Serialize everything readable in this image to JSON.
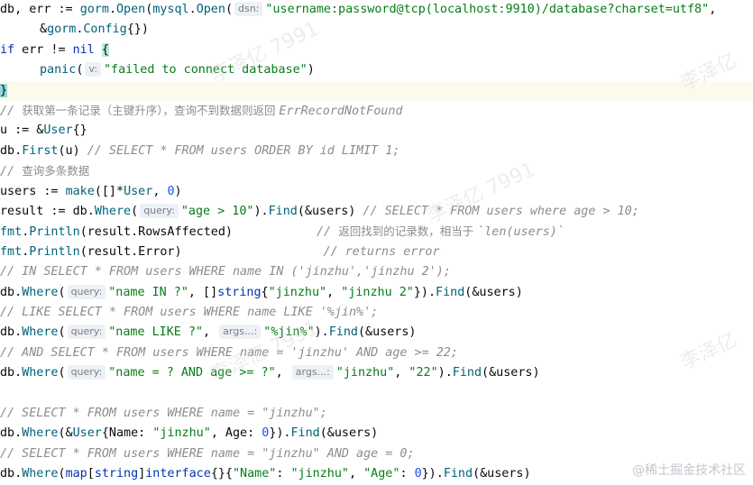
{
  "code": {
    "l1": {
      "a": "db, err := ",
      "gorm": "gorm",
      "dot1": ".",
      "open1": "Open",
      "p1": "(",
      "mysql": "mysql",
      "dot2": ".",
      "open2": "Open",
      "p2": "(",
      "hint": "dsn:",
      "str": "\"username:password@tcp(localhost:9910)/database?charset=utf8\"",
      "end": ","
    },
    "l2": {
      "amp": "&",
      "gorm": "gorm",
      "dot": ".",
      "config": "Config",
      "end": "{})"
    },
    "l3": {
      "if": "if",
      "mid": " err != ",
      "nil": "nil",
      "sp": " ",
      "brace": "{"
    },
    "l4": {
      "panic": "panic",
      "p": "(",
      "hint": "v:",
      "str": "\"failed to connect database\"",
      "end": ")"
    },
    "l5": {
      "brace": "}"
    },
    "l6": {
      "c1": "// ",
      "zh": "获取第一条记录（主键升序），查询不到数据则返回 ",
      "c2": "ErrRecordNotFound"
    },
    "l7": {
      "a": "u := &",
      "user": "User",
      "end": "{}"
    },
    "l8": {
      "a": "db.",
      "first": "First",
      "b": "(u) ",
      "cm": "// SELECT * FROM users ORDER BY id LIMIT 1;"
    },
    "l9": {
      "c1": "// ",
      "zh": "查询多条数据"
    },
    "l10": {
      "a": "users := ",
      "make": "make",
      "b": "([]*",
      "user": "User",
      "c": ", ",
      "zero": "0",
      "end": ")"
    },
    "l11": {
      "a": "result := db.",
      "where": "Where",
      "p": "(",
      "hint": "query:",
      "str": "\"age > 10\"",
      "b": ").",
      "find": "Find",
      "c": "(&users) ",
      "cm": "// SELECT * FROM users where age > 10;"
    },
    "l12": {
      "fmt": "fmt",
      "dot": ".",
      "println": "Println",
      "a": "(result.RowsAffected)",
      "c1": "// ",
      "zh": "返回找到的记录数，相当于 ",
      "c2": "`len(users)`"
    },
    "l13": {
      "fmt": "fmt",
      "dot": ".",
      "println": "Println",
      "a": "(result.Error)",
      "cm": "// returns error"
    },
    "l14": {
      "cm": "// IN SELECT * FROM users WHERE name IN ('jinzhu','jinzhu 2');"
    },
    "l15": {
      "a": "db.",
      "where": "Where",
      "p": "(",
      "hint": "query:",
      "str1": "\"name IN ?\"",
      "b": ", []",
      "string": "string",
      "c": "{",
      "str2": "\"jinzhu\"",
      "d": ", ",
      "str3": "\"jinzhu 2\"",
      "e": "}).",
      "find": "Find",
      "end": "(&users)"
    },
    "l16": {
      "cm": "// LIKE SELECT * FROM users WHERE name LIKE '%jin%';"
    },
    "l17": {
      "a": "db.",
      "where": "Where",
      "p": "(",
      "hint": "query:",
      "str1": "\"name LIKE ?\"",
      "c": ", ",
      "hint2": "args...:",
      "str2": "\"%jin%\"",
      "d": ").",
      "find": "Find",
      "end": "(&users)"
    },
    "l18": {
      "cm": "// AND SELECT * FROM users WHERE name = 'jinzhu' AND age >= 22;"
    },
    "l19": {
      "a": "db.",
      "where": "Where",
      "p": "(",
      "hint": "query:",
      "str1": "\"name = ? AND age >= ?\"",
      "c": ", ",
      "hint2": "args...:",
      "str2": "\"jinzhu\"",
      "d": ", ",
      "str3": "\"22\"",
      "e": ").",
      "find": "Find",
      "end": "(&users)"
    },
    "l21": {
      "cm": "// SELECT * FROM users WHERE name = \"jinzhu\";"
    },
    "l22": {
      "a": "db.",
      "where": "Where",
      "b": "(&",
      "user": "User",
      "c": "{Name: ",
      "str": "\"jinzhu\"",
      "d": ", Age: ",
      "zero": "0",
      "e": "}).",
      "find": "Find",
      "end": "(&users)"
    },
    "l23": {
      "cm": "// SELECT * FROM users WHERE name = \"jinzhu\" AND age = 0;"
    },
    "l24": {
      "a": "db.",
      "where": "Where",
      "b": "(",
      "map": "map",
      "c": "[",
      "string": "string",
      "d": "]",
      "iface": "interface",
      "e": "{}{",
      "str1": "\"Name\"",
      "f": ": ",
      "str2": "\"jinzhu\"",
      "g": ", ",
      "str3": "\"Age\"",
      "h": ": ",
      "zero": "0",
      "i": "}).",
      "find": "Find",
      "end": "(&users)"
    }
  },
  "watermark": {
    "footer": "@稀土掘金技术社区",
    "w1": "李泽亿 7991",
    "w2": "李泽亿",
    "w3": "李泽亿 7991",
    "w4": "李泽亿",
    "w5": "李泽亿 7991"
  },
  "colors": {
    "keyword": "#0033b3",
    "function": "#00627a",
    "string": "#067d17",
    "number": "#1750eb",
    "comment": "#8c8c8c",
    "current_line": "#fcfaed"
  }
}
